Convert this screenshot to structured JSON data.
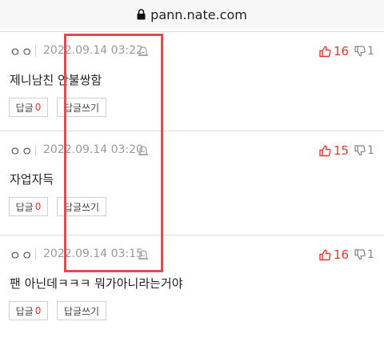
{
  "browser": {
    "url": "pann.nate.com"
  },
  "comments": [
    {
      "nickname": "ㅇㅇ",
      "date": "2022.09.14 03:22",
      "text": "제니남친 안불쌍함",
      "likes": "16",
      "dislikes": "1",
      "reply_label": "답글",
      "reply_count": "0",
      "write_reply_label": "답글쓰기"
    },
    {
      "nickname": "ㅇㅇ",
      "date": "2022.09.14 03:20",
      "text": "자업자득",
      "likes": "15",
      "dislikes": "1",
      "reply_label": "답글",
      "reply_count": "0",
      "write_reply_label": "답글쓰기"
    },
    {
      "nickname": "ㅇㅇ",
      "date": "2022.09.14 03:15",
      "text": "팬 아닌데ㅋㅋㅋ 뭐가아니라는거야",
      "likes": "16",
      "dislikes": "1",
      "reply_label": "답글",
      "reply_count": "0",
      "write_reply_label": "답글쓰기"
    }
  ],
  "colors": {
    "like": "#e8352f",
    "highlight_box": "#e24a4f"
  }
}
